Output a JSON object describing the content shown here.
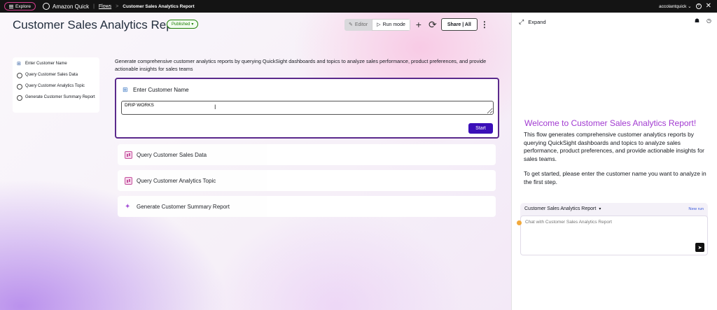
{
  "topbar": {
    "explore_label": "Explore",
    "app_name": "Amazon Quick",
    "breadcrumb_flows": "Flows",
    "breadcrumb_separator": ">",
    "breadcrumb_current": "Customer Sales Analytics Report",
    "account_name": "accolantquick",
    "account_caret": "⌄",
    "help_glyph": "?",
    "close_glyph": "✕",
    "icons": {
      "explore": "menu-icon",
      "logo": "amazon-quick-logo-icon",
      "help": "help-icon",
      "close": "close-icon"
    }
  },
  "header": {
    "title": "Customer Sales Analytics Report",
    "status_badge": "Published",
    "status_caret": "▾",
    "editor_label": "Editor",
    "run_mode_label": "Run mode",
    "add_glyph": "+",
    "sync_glyph": "⟳",
    "share_label": "Share | All",
    "kebab_glyph": "⋮",
    "editor_glyph": "✎",
    "run_glyph": "▷",
    "colors": {
      "badge_green": "#1d8102",
      "primary": "#3b0fb8",
      "active_border": "#5b2a8c"
    }
  },
  "steps": [
    {
      "label": "Enter Customer Name",
      "glyph": "⊞"
    },
    {
      "label": "Query Customer Sales Data"
    },
    {
      "label": "Query Customer Analytics Topic"
    },
    {
      "label": "Generate Customer Summary Report"
    }
  ],
  "description": "Generate comprehensive customer analytics reports by querying QuickSight dashboards and topics to analyze sales performance, product preferences, and provide actionable insights for sales teams",
  "active_step": {
    "title": "Enter Customer Name",
    "title_glyph": "⊞",
    "input_value": "DRIP WORKS",
    "cursor_glyph": "I",
    "start_label": "Start"
  },
  "step_cards": [
    {
      "label": "Query Customer Sales Data",
      "icon": "quicksight-dashboard-icon"
    },
    {
      "label": "Query Customer Analytics Topic",
      "icon": "quicksight-dashboard-icon"
    },
    {
      "label": "Generate Customer Summary Report",
      "icon": "sparkle-icon",
      "glyph": "✦"
    }
  ],
  "right_panel": {
    "expand_label": "Expand",
    "expand_glyph": "⤢",
    "icon_glyph_1": "☗",
    "icon_glyph_2": "◷",
    "welcome_title": "Welcome to Customer Sales Analytics Report!",
    "paragraph_1": "This flow generates comprehensive customer analytics reports by querying QuickSight dashboards and topics to analyze sales performance, product preferences, and provide actionable insights for sales teams.",
    "paragraph_2": "To get started, please enter the customer name you want to analyze in the first step.",
    "chat_title": "Customer Sales Analytics Report",
    "chat_caret": "▾",
    "new_run_label": "New run",
    "chat_placeholder": "Chat with Customer Sales Analytics Report",
    "send_glyph": "➤",
    "colors": {
      "welcome": "#a23bd1",
      "new_run": "#3b5bdb",
      "indicator": "#f2a93b"
    }
  }
}
